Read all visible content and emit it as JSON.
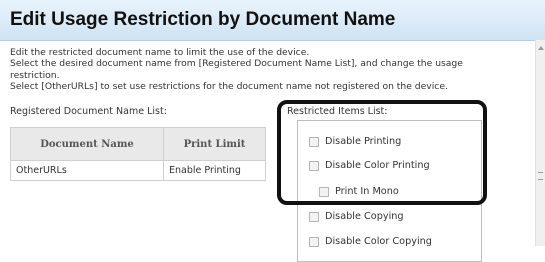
{
  "header": {
    "title": "Edit Usage Restriction by Document Name"
  },
  "description": {
    "lines": [
      "Edit the restricted document name to limit the use of the device.",
      "Select the desired document name from [Registered Document Name List], and change the usage",
      "restriction.",
      "Select [OtherURLs] to set use restrictions for the document name not registered on the device."
    ]
  },
  "registered": {
    "label": "Registered Document Name List:",
    "columns": [
      "Document Name",
      "Print Limit"
    ],
    "rows": [
      {
        "name": "OtherURLs",
        "limit": "Enable Printing"
      }
    ]
  },
  "restricted": {
    "label": "Restricted Items List:",
    "items": [
      "Disable Printing",
      "Disable Color Printing",
      "Print In Mono",
      "Disable Copying",
      "Disable Color Copying"
    ]
  }
}
